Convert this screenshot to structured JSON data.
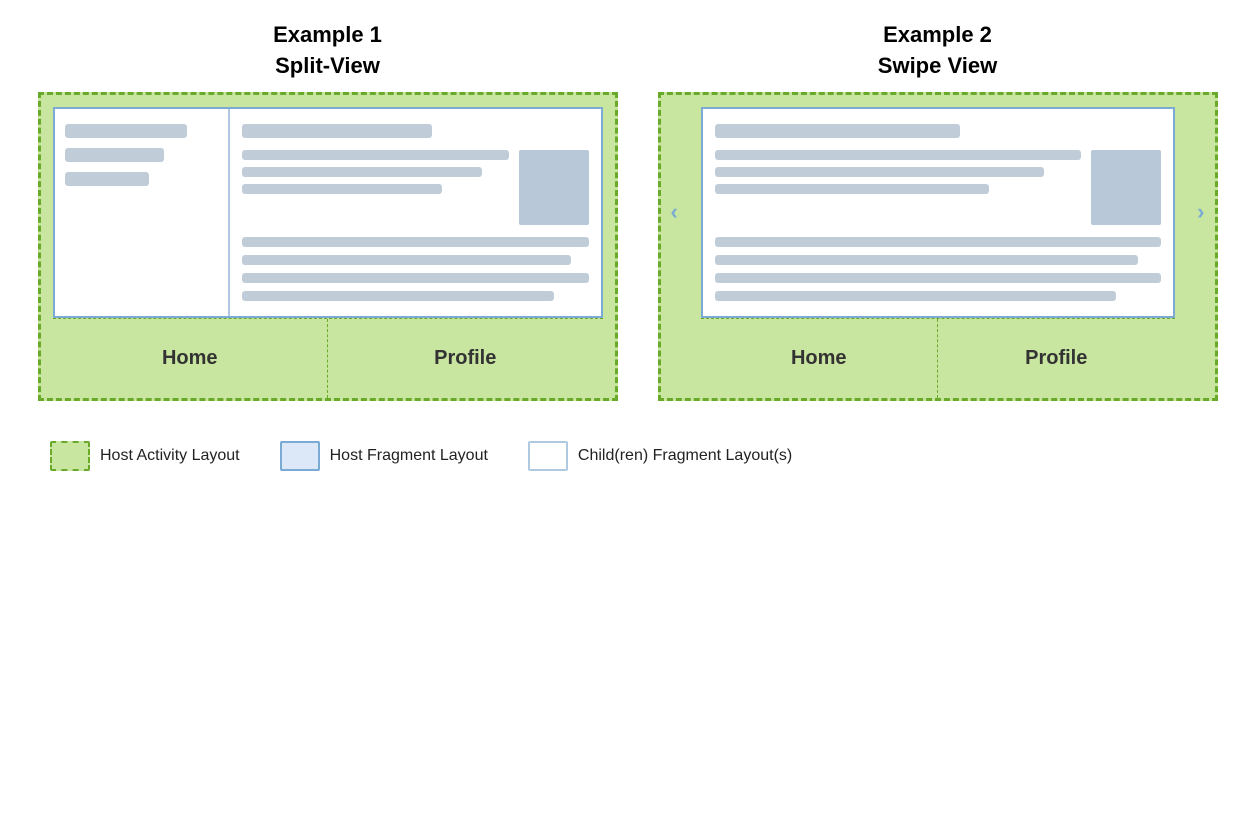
{
  "example1": {
    "title_line1": "Example 1",
    "title_line2": "Split-View",
    "sidebar": {
      "lines": [
        {
          "width": "80%",
          "type": "long"
        },
        {
          "width": "65%",
          "type": "medium"
        },
        {
          "width": "55%",
          "type": "short"
        }
      ]
    },
    "detail": {
      "header_width": "55%",
      "content_lines": [
        {
          "width": "100%"
        },
        {
          "width": "90%"
        },
        {
          "width": "75%"
        }
      ],
      "standalone_lines": [
        {
          "width": "100%"
        },
        {
          "width": "95%"
        },
        {
          "width": "100%"
        },
        {
          "width": "90%"
        }
      ]
    },
    "nav": {
      "home": "Home",
      "profile": "Profile"
    }
  },
  "example2": {
    "title_line1": "Example 2",
    "title_line2": "Swipe View",
    "detail": {
      "header_width": "55%",
      "content_lines": [
        {
          "width": "100%"
        },
        {
          "width": "90%"
        },
        {
          "width": "75%"
        }
      ],
      "standalone_lines": [
        {
          "width": "100%"
        },
        {
          "width": "95%"
        },
        {
          "width": "100%"
        },
        {
          "width": "90%"
        }
      ]
    },
    "nav": {
      "home": "Home",
      "profile": "Profile"
    },
    "swipe_left": "‹",
    "swipe_right": "›"
  },
  "legend": {
    "items": [
      {
        "label": "Host Activity Layout",
        "type": "host-activity-color"
      },
      {
        "label": "Host Fragment Layout",
        "type": "host-fragment-color"
      },
      {
        "label": "Child(ren) Fragment Layout(s)",
        "type": "child-fragment-color"
      }
    ]
  }
}
